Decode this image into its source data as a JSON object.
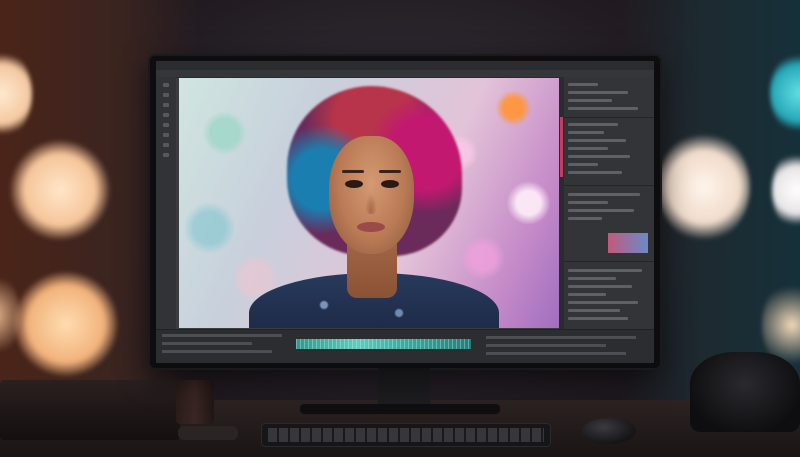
{
  "scene": {
    "description_colors": {
      "left_light": "#f4c8a0",
      "right_light": "#27a9b8",
      "accent_timeline": "#5fe0cf"
    }
  },
  "editor": {
    "menu_items": [
      "",
      "",
      "",
      "",
      "",
      "",
      "",
      "",
      "",
      "",
      ""
    ]
  }
}
